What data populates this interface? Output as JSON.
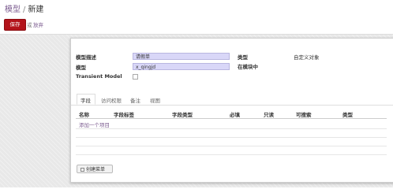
{
  "breadcrumb": {
    "parent": "模型",
    "separator": "/",
    "current": "新建"
  },
  "toolbar": {
    "save_label": "保存",
    "or_label": "或",
    "discard_label": "放弃"
  },
  "form": {
    "model_description": {
      "label": "模型描述",
      "value": "请假单"
    },
    "model": {
      "label": "模型",
      "value": "x_qingjd"
    },
    "transient": {
      "label": "Transient Model",
      "checked": false
    },
    "type": {
      "label": "类型",
      "value": "自定义对象"
    },
    "in_modules": {
      "label": "在模块中",
      "value": ""
    }
  },
  "tabs": [
    {
      "label": "字段",
      "active": true
    },
    {
      "label": "访问权限",
      "active": false
    },
    {
      "label": "备注",
      "active": false
    },
    {
      "label": "视图",
      "active": false
    }
  ],
  "fields_table": {
    "columns": [
      "名称",
      "字段标签",
      "字段类型",
      "必填",
      "只读",
      "可搜索",
      "类型"
    ],
    "add_item_label": "添加一个项目"
  },
  "create_menu_label": "创建菜单",
  "colors": {
    "accent": "#7b5b8f",
    "save_button": "#b3131b",
    "input_required": "#d9d7f8"
  }
}
